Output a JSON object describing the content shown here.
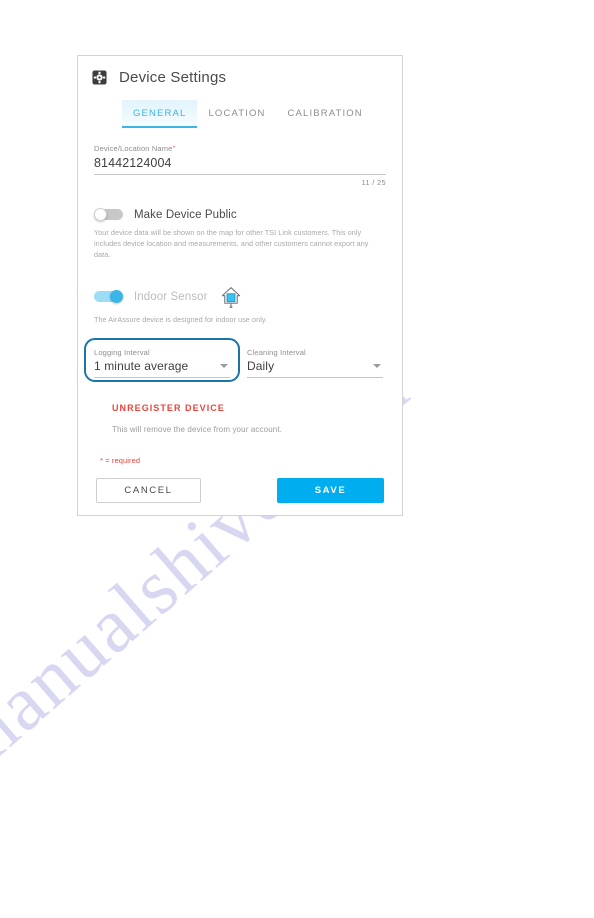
{
  "watermark": {
    "text": "manualshive.com"
  },
  "card": {
    "title": "Device Settings",
    "icon": "gear-square-icon",
    "tabs": [
      {
        "label": "GENERAL",
        "active": true
      },
      {
        "label": "LOCATION",
        "active": false
      },
      {
        "label": "CALIBRATION",
        "active": false
      }
    ],
    "device_name_field": {
      "label": "Device/Location Name",
      "required_marker": "*",
      "value": "81442124004",
      "placeholder": "",
      "counter": "11 / 25"
    },
    "make_public": {
      "label": "Make Device Public",
      "state": "off",
      "helper": "Your device data will be shown on the map for other TSI Link customers. This only includes device location and measurements, and other customers cannot export any data."
    },
    "indoor_sensor": {
      "label": "Indoor Sensor",
      "state": "on",
      "disabled": true,
      "icon": "house-icon",
      "helper": "The AirAssure device is designed for indoor use only."
    },
    "logging_interval": {
      "label": "Logging Interval",
      "value": "1 minute average",
      "highlighted": true
    },
    "cleaning_interval": {
      "label": "Cleaning Interval",
      "value": "Daily"
    },
    "unregister": {
      "link_label": "UNREGISTER DEVICE",
      "description": "This will remove the device from your account."
    },
    "required_note": "* = required",
    "buttons": {
      "cancel": "CANCEL",
      "save": "SAVE"
    }
  },
  "colors": {
    "accent_blue": "#3cb4e5",
    "save_blue": "#00aeef",
    "danger_red": "#e8453c",
    "highlight_stroke": "#1b75a8",
    "muted_text": "#a8a8a8",
    "watermark": "#a9a8e4"
  }
}
